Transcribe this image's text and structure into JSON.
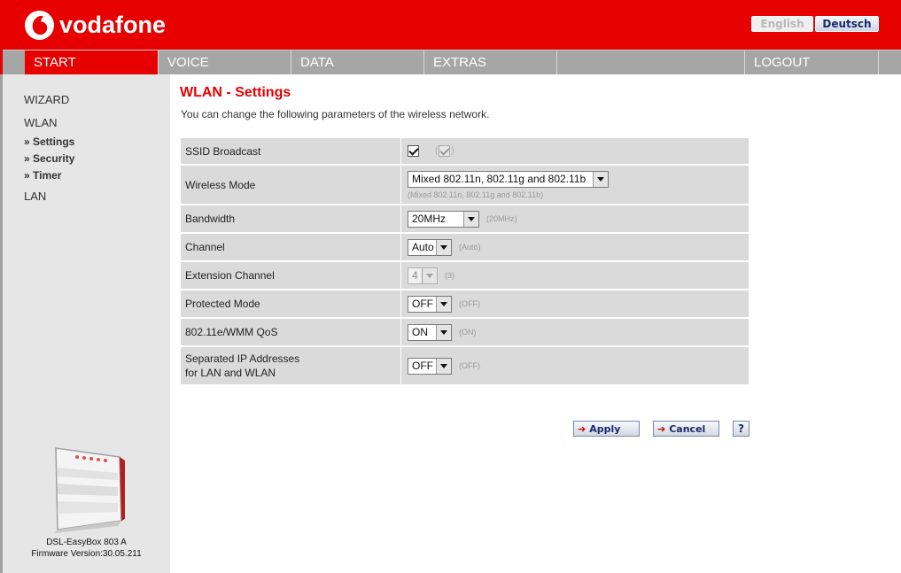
{
  "brand": {
    "name": "vodafone"
  },
  "languages": {
    "english": "English",
    "deutsch": "Deutsch"
  },
  "nav": {
    "start": "START",
    "voice": "VOICE",
    "data": "DATA",
    "extras": "EXTRAS",
    "logout": "LOGOUT"
  },
  "sidebar": {
    "wizard": "WIZARD",
    "wlan": "WLAN",
    "sub": [
      "» Settings",
      "» Security",
      "» Timer"
    ],
    "lan": "LAN",
    "device_name": "DSL-EasyBox 803 A",
    "firmware": "Firmware Version:30.05.211"
  },
  "page": {
    "title": "WLAN - Settings",
    "description": "You can change the following parameters of the wireless network."
  },
  "settings": {
    "ssid_broadcast": {
      "label": "SSID Broadcast",
      "checked": true,
      "default_checked": true
    },
    "wireless_mode": {
      "label": "Wireless Mode",
      "value": "Mixed 802.11n, 802.11g and 802.11b",
      "hint": "(Mixed 802.11n, 802.11g and 802.11b)"
    },
    "bandwidth": {
      "label": "Bandwidth",
      "value": "20MHz",
      "hint": "(20MHz)"
    },
    "channel": {
      "label": "Channel",
      "value": "Auto",
      "hint": "(Auto)"
    },
    "extension_channel": {
      "label": "Extension Channel",
      "value": "4",
      "hint": "(3)"
    },
    "protected_mode": {
      "label": "Protected Mode",
      "value": "OFF",
      "hint": "(OFF)"
    },
    "wmm_qos": {
      "label": "802.11e/WMM QoS",
      "value": "ON",
      "hint": "(ON)"
    },
    "separated_ip": {
      "label_line1": "Separated IP Addresses",
      "label_line2": "for LAN and WLAN",
      "value": "OFF",
      "hint": "(OFF)"
    }
  },
  "buttons": {
    "apply": "Apply",
    "cancel": "Cancel",
    "help": "?"
  },
  "colors": {
    "brand_red": "#e60000",
    "nav_gray": "#a6a6a6",
    "row_gray": "#dadada",
    "sidebar_gray": "#e6e6e6"
  }
}
